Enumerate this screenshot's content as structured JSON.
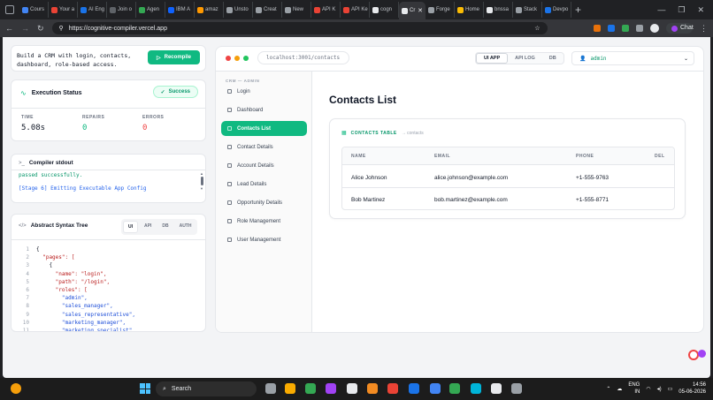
{
  "browser": {
    "tabs": [
      {
        "label": "Cours",
        "color": "#4285f4"
      },
      {
        "label": "Your a",
        "color": "#ea4335"
      },
      {
        "label": "AI Eng",
        "color": "#1a73e8"
      },
      {
        "label": "Join o",
        "color": "#5f6368"
      },
      {
        "label": "Agen",
        "color": "#34a853"
      },
      {
        "label": "IBM A",
        "color": "#0f62fe"
      },
      {
        "label": "amaz",
        "color": "#ff9900"
      },
      {
        "label": "Unsto",
        "color": "#9aa0a6"
      },
      {
        "label": "Creat",
        "color": "#9aa0a6"
      },
      {
        "label": "New",
        "color": "#9aa0a6"
      },
      {
        "label": "API K",
        "color": "#ea4335"
      },
      {
        "label": "API Ke",
        "color": "#ea4335"
      },
      {
        "label": "cogn",
        "color": "#e8eaed"
      },
      {
        "label": "Cr",
        "color": "#e8eaed"
      },
      {
        "label": "Forge",
        "color": "#9aa0a6"
      },
      {
        "label": "Home",
        "color": "#fbbc04"
      },
      {
        "label": "bnssa",
        "color": "#e8eaed"
      },
      {
        "label": "Stack",
        "color": "#9aa0a6"
      },
      {
        "label": "Devpo",
        "color": "#1a73e8"
      }
    ],
    "active_tab_index": 13,
    "url": "https://cognitive-compiler.vercel.app",
    "chat_label": "Chat"
  },
  "left": {
    "prompt": "Build a CRM with login, contacts, dashboard, role-based access.",
    "recompile_label": "Recompile",
    "execution": {
      "title": "Execution Status",
      "status": "Success",
      "time_label": "TIME",
      "time_value": "5.08s",
      "repairs_label": "REPAIRS",
      "repairs_value": "0",
      "errors_label": "ERRORS",
      "errors_value": "0"
    },
    "stdout": {
      "title": "Compiler stdout",
      "lines": [
        "passed successfully.",
        "[Stage 6] Emitting Executable App Config"
      ]
    },
    "ast": {
      "title": "Abstract Syntax Tree",
      "tabs": [
        "UI",
        "API",
        "DB",
        "AUTH"
      ],
      "active_tab": "UI",
      "lines": [
        {
          "n": "1",
          "text": "{"
        },
        {
          "n": "2",
          "text": "  \"pages\": ["
        },
        {
          "n": "3",
          "text": "    {"
        },
        {
          "n": "4",
          "text": "      \"name\": \"login\","
        },
        {
          "n": "5",
          "text": "      \"path\": \"/login\","
        },
        {
          "n": "6",
          "text": "      \"roles\": ["
        },
        {
          "n": "7",
          "text": "        \"admin\","
        },
        {
          "n": "8",
          "text": "        \"sales_manager\","
        },
        {
          "n": "9",
          "text": "        \"sales_representative\","
        },
        {
          "n": "10",
          "text": "        \"marketing_manager\","
        },
        {
          "n": "11",
          "text": "        \"marketing_specialist\""
        }
      ]
    }
  },
  "app": {
    "url": "localhost:3001/contacts",
    "views": [
      "UI APP",
      "API LOG",
      "DB"
    ],
    "active_view": "UI APP",
    "role": "admin",
    "sidebar_header": "CRM — ADMIN",
    "nav": [
      "Login",
      "Dashboard",
      "Contacts List",
      "Contact Details",
      "Account Details",
      "Lead Details",
      "Opportunity Details",
      "Role Management",
      "User Management"
    ],
    "active_nav": "Contacts List",
    "page_title": "Contacts List",
    "table_label": "CONTACTS TABLE",
    "table_source": "→ contacts",
    "columns": [
      "NAME",
      "EMAIL",
      "PHONE",
      "DEL"
    ],
    "rows": [
      {
        "name": "Alice Johnson",
        "email": "alice.johnson@example.com",
        "phone": "+1-555-9763"
      },
      {
        "name": "Bob Martinez",
        "email": "bob.martinez@example.com",
        "phone": "+1-555-8771"
      }
    ]
  },
  "taskbar": {
    "search": "Search",
    "lang1": "ENG",
    "lang2": "IN",
    "time": "14:56",
    "date": "05-06-2026"
  }
}
